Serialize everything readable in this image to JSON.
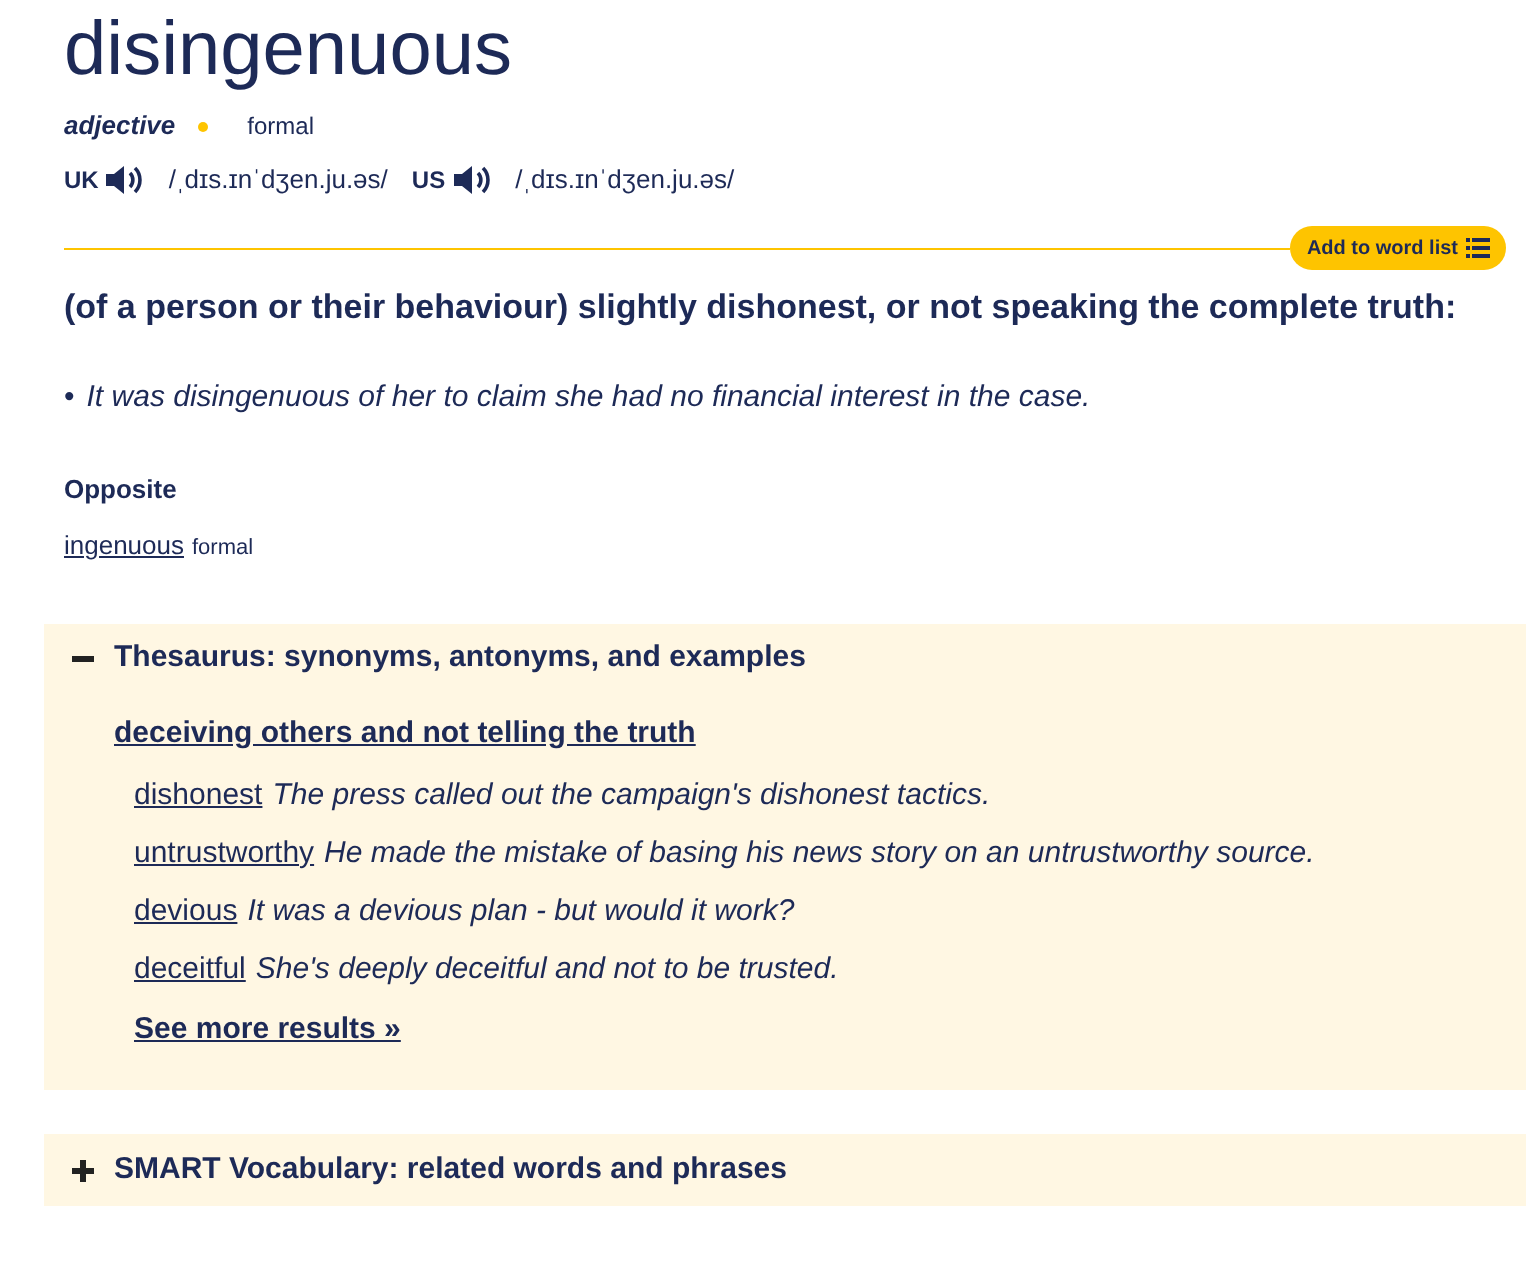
{
  "headword": "disingenuous",
  "pos": "adjective",
  "register": "formal",
  "pronunciations": [
    {
      "region": "UK",
      "ipa": "/ˌdɪs.ɪnˈdʒen.ju.əs/"
    },
    {
      "region": "US",
      "ipa": "/ˌdɪs.ɪnˈdʒen.ju.əs/"
    }
  ],
  "add_button": "Add to word list",
  "definition": "(of a person or their behaviour) slightly dishonest, or not speaking the complete truth:",
  "examples": [
    {
      "marker": "•",
      "text": "It was disingenuous of her to claim she had no financial interest in the case."
    }
  ],
  "opposite": {
    "heading": "Opposite",
    "word": "ingenuous",
    "register": "formal"
  },
  "panels": [
    {
      "title": "Thesaurus: synonyms, antonyms, and examples",
      "expanded": true,
      "heading": "deceiving others and not telling the truth",
      "entries": [
        {
          "word": "dishonest",
          "example": "The press called out the campaign's dishonest tactics."
        },
        {
          "word": "untrustworthy",
          "example": "He made the mistake of basing his news story on an untrustworthy source."
        },
        {
          "word": "devious",
          "example": "It was a devious plan - but would it work?"
        },
        {
          "word": "deceitful",
          "example": "She's deeply deceitful and not to be trusted."
        }
      ],
      "more": "See more results »"
    },
    {
      "title": "SMART Vocabulary: related words and phrases",
      "expanded": false
    }
  ]
}
